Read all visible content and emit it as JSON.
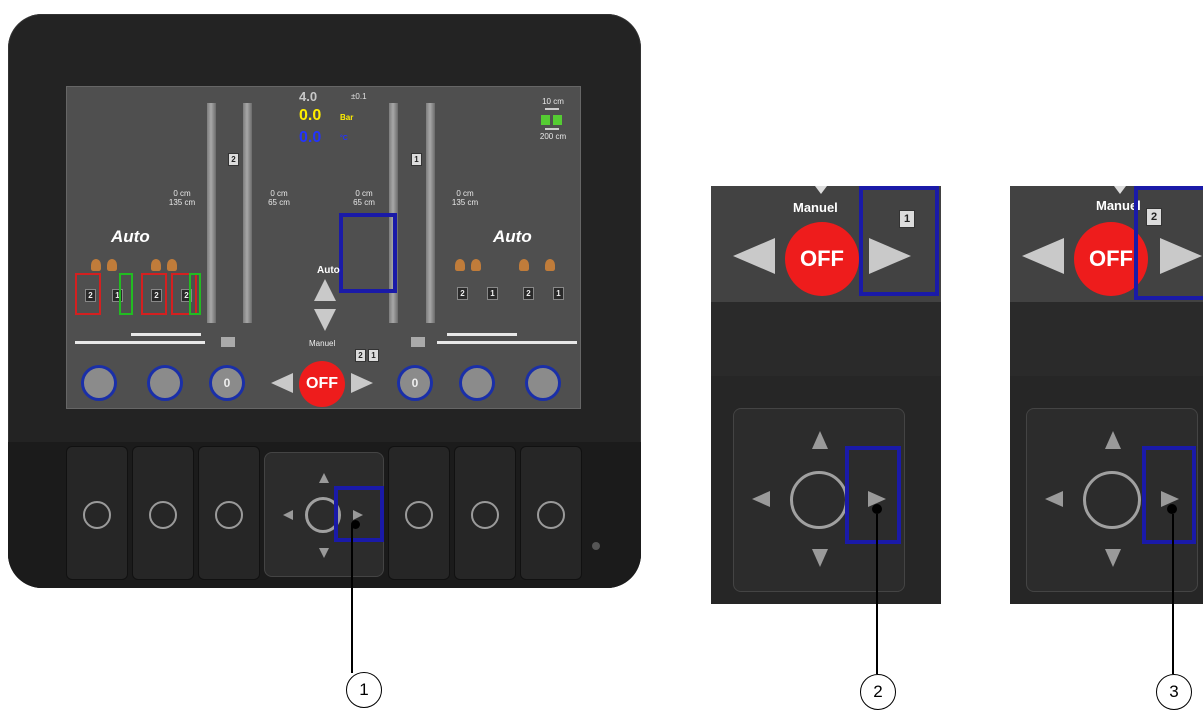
{
  "screen": {
    "target_pressure": "4.0",
    "tolerance": "±0.1",
    "pressure_value": "0.0",
    "pressure_unit": "Bar",
    "temp_value": "0.0",
    "temp_unit": "°C",
    "spacing_top": "10 cm",
    "spacing_bottom": "200 cm",
    "left_mode": "Auto",
    "right_mode": "Auto",
    "mode_up_label": "Auto",
    "mode_down_label": "Manuel",
    "off_label": "OFF",
    "counter_left": "0",
    "counter_right": "0",
    "section_labels": [
      "2",
      "1"
    ],
    "columns": [
      {
        "top": "0 cm",
        "bottom": "135 cm"
      },
      {
        "top": "0 cm",
        "bottom": "65 cm"
      },
      {
        "top": "0 cm",
        "bottom": "65 cm"
      },
      {
        "top": "0 cm",
        "bottom": "135 cm"
      }
    ],
    "bar_badges": [
      "2",
      "1"
    ],
    "left_sections": [
      "2",
      "1",
      "2",
      "2"
    ],
    "right_sections": [
      "2",
      "1",
      "2",
      "1"
    ]
  },
  "zoom": [
    {
      "label": "Manuel",
      "off": "OFF",
      "badge": "1"
    },
    {
      "label": "Manuel",
      "off": "OFF",
      "badge": "2"
    }
  ],
  "callouts": [
    "1",
    "2",
    "3"
  ],
  "colors": {
    "highlight": "#1a1aa8",
    "pressure": "#ffee00",
    "temperature": "#2233ff",
    "off": "#ee1c1c",
    "section_red": "#d42020",
    "section_green": "#22bb22"
  }
}
